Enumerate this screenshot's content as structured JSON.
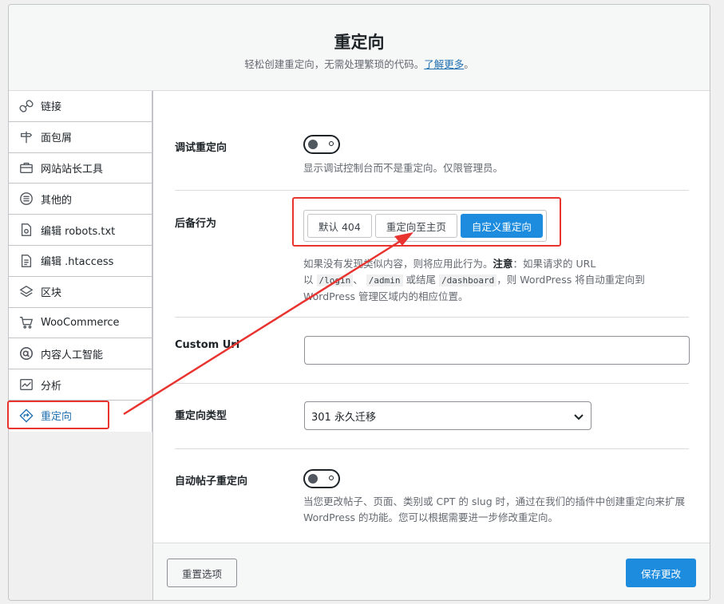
{
  "header": {
    "title": "重定向",
    "subtitle": "轻松创建重定向，无需处理繁琐的代码。",
    "learn_more": "了解更多",
    "subtitle_end": "。"
  },
  "sidebar": {
    "items": [
      {
        "label": "链接",
        "icon": "link-icon"
      },
      {
        "label": "面包屑",
        "icon": "signpost-icon"
      },
      {
        "label": "网站站长工具",
        "icon": "toolbox-icon"
      },
      {
        "label": "其他的",
        "icon": "list-circle-icon"
      },
      {
        "label": "编辑 robots.txt",
        "icon": "file-gear-icon"
      },
      {
        "label": "编辑 .htaccess",
        "icon": "file-text-icon"
      },
      {
        "label": "区块",
        "icon": "block-icon"
      },
      {
        "label": "WooCommerce",
        "icon": "cart-icon"
      },
      {
        "label": "内容人工智能",
        "icon": "ai-icon"
      },
      {
        "label": "分析",
        "icon": "chart-icon"
      },
      {
        "label": "重定向",
        "icon": "redirect-icon",
        "active": true
      }
    ]
  },
  "settings": {
    "debug": {
      "label": "调试重定向",
      "description": "显示调试控制台而不是重定向。仅限管理员。",
      "enabled": false
    },
    "fallback": {
      "label": "后备行为",
      "options": [
        "默认 404",
        "重定向至主页",
        "自定义重定向"
      ],
      "selected": "自定义重定向",
      "desc_1": "如果没有发现类似内容，则将应用此行为。",
      "desc_note": "注意",
      "desc_2": "：如果请求的 URL",
      "desc_3": "以",
      "code_1": "/login",
      "desc_4": "、",
      "code_2": "/admin",
      "desc_5": "或结尾",
      "code_3": "/dashboard",
      "desc_6": "，则 WordPress 将自动重定向到",
      "desc_7": "WordPress 管理区域内的相应位置。"
    },
    "custom_url": {
      "label": "Custom Url",
      "value": ""
    },
    "redirect_type": {
      "label": "重定向类型",
      "value": "301 永久迁移"
    },
    "auto_post": {
      "label": "自动帖子重定向",
      "description_1": "当您更改帖子、页面、类别或 CPT 的 slug 时，通过在我们的插件中创建重定向来扩展",
      "description_2": "WordPress 的功能。您可以根据需要进一步修改重定向。",
      "enabled": false
    }
  },
  "footer": {
    "reset_label": "重置选项",
    "save_label": "保存更改"
  },
  "colors": {
    "accent": "#1e8cde",
    "highlight": "#e8332f",
    "link": "#2271b1"
  }
}
